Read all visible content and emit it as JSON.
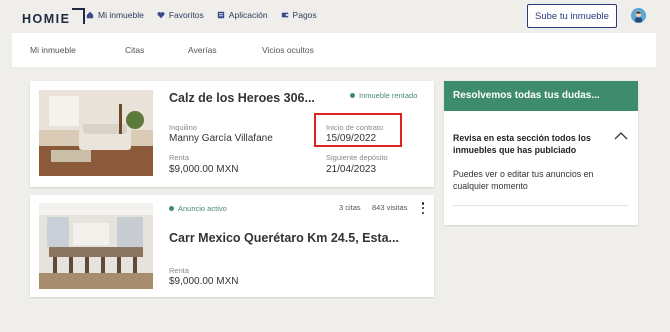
{
  "brand": {
    "logo": "HOMIE"
  },
  "topnav": [
    {
      "label": "Mi inmueble",
      "icon": "home-icon"
    },
    {
      "label": "Favoritos",
      "icon": "heart-icon"
    },
    {
      "label": "Aplicación",
      "icon": "application-icon"
    },
    {
      "label": "Pagos",
      "icon": "wallet-icon"
    }
  ],
  "header": {
    "publish_label": "Sube tu inmueble"
  },
  "subnav": [
    "Mi inmueble",
    "Citas",
    "Averías",
    "Vicios ocultos"
  ],
  "properties": [
    {
      "title": "Calz de los Heroes 306...",
      "status": "Inmueble rentado",
      "tenant_label": "Inquilino",
      "tenant": "Manny García Villafane",
      "contract_label": "Inicio de contrato",
      "contract_date": "15/09/2022",
      "rent_label": "Renta",
      "rent": "$9,000.00 MXN",
      "next_label": "Siguiente depósito",
      "next_date": "21/04/2023"
    },
    {
      "title": "Carr Mexico Querétaro Km 24.5, Esta...",
      "status": "Anuncio activo",
      "appointments": "3 citas",
      "visits": "843 visitas",
      "rent_label": "Renta",
      "rent": "$9,000.00 MXN"
    }
  ],
  "faq": {
    "header": "Resolvemos todas tus dudas...",
    "question": "Revisa en esta sección todos los inmuebles que has publciado",
    "answer": "Puedes ver o editar tus anuncios en cualquier momento"
  },
  "colors": {
    "accent_green": "#3e8c6d",
    "navy": "#2b3a7c",
    "highlight_red": "#dd2222"
  }
}
